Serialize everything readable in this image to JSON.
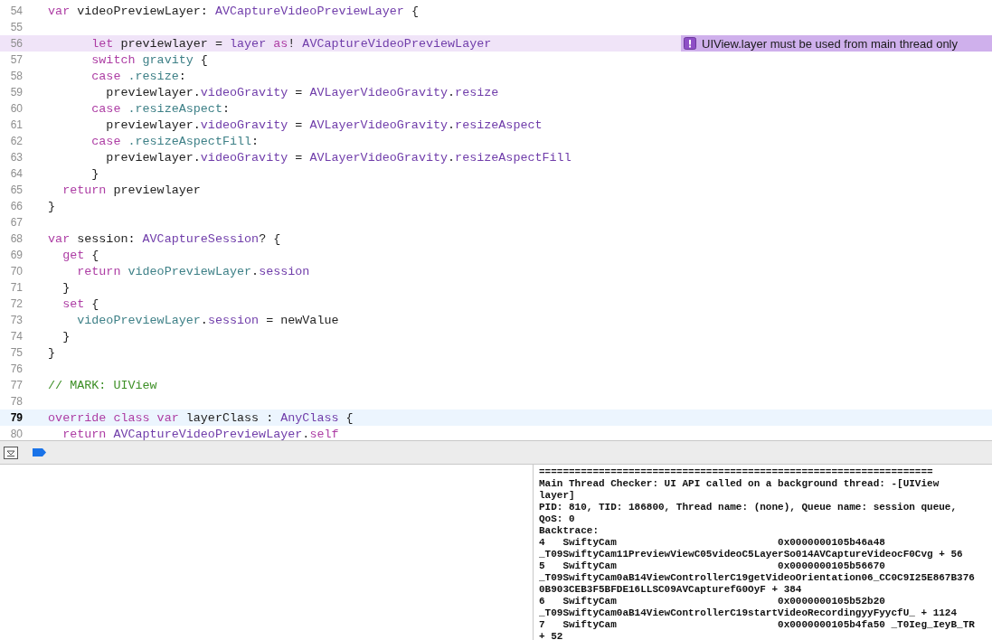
{
  "editor": {
    "lines": [
      {
        "number": "54",
        "kind": "normal",
        "tokens": [
          {
            "kind": "kw",
            "text": "  var"
          },
          {
            "kind": "plain",
            "text": " videoPreviewLayer: "
          },
          {
            "kind": "type",
            "text": "AVCaptureVideoPreviewLayer"
          },
          {
            "kind": "plain",
            "text": " {"
          }
        ]
      },
      {
        "number": "55",
        "kind": "normal"
      },
      {
        "number": "56",
        "kind": "issue",
        "issue": {
          "text": "UIView.layer must be used from main thread only"
        },
        "tokens": [
          {
            "kind": "kw",
            "text": "        let"
          },
          {
            "kind": "plain",
            "text": " previewlayer = "
          },
          {
            "kind": "sys",
            "text": "layer"
          },
          {
            "kind": "kw",
            "text": " as"
          },
          {
            "kind": "plain",
            "text": "! "
          },
          {
            "kind": "type",
            "text": "AVCaptureVideoPreviewLayer"
          }
        ]
      },
      {
        "number": "57",
        "kind": "normal",
        "tokens": [
          {
            "kind": "kw",
            "text": "        switch"
          },
          {
            "kind": "proj",
            "text": " gravity"
          },
          {
            "kind": "plain",
            "text": " {"
          }
        ]
      },
      {
        "number": "58",
        "kind": "normal",
        "tokens": [
          {
            "kind": "kw",
            "text": "        case"
          },
          {
            "kind": "proj",
            "text": " .resize"
          },
          {
            "kind": "plain",
            "text": ":"
          }
        ]
      },
      {
        "number": "59",
        "kind": "normal",
        "tokens": [
          {
            "kind": "plain",
            "text": "          previewlayer."
          },
          {
            "kind": "sys",
            "text": "videoGravity"
          },
          {
            "kind": "plain",
            "text": " = "
          },
          {
            "kind": "type",
            "text": "AVLayerVideoGravity"
          },
          {
            "kind": "plain",
            "text": "."
          },
          {
            "kind": "sys",
            "text": "resize"
          }
        ]
      },
      {
        "number": "60",
        "kind": "normal",
        "tokens": [
          {
            "kind": "kw",
            "text": "        case"
          },
          {
            "kind": "proj",
            "text": " .resizeAspect"
          },
          {
            "kind": "plain",
            "text": ":"
          }
        ]
      },
      {
        "number": "61",
        "kind": "normal",
        "tokens": [
          {
            "kind": "plain",
            "text": "          previewlayer."
          },
          {
            "kind": "sys",
            "text": "videoGravity"
          },
          {
            "kind": "plain",
            "text": " = "
          },
          {
            "kind": "type",
            "text": "AVLayerVideoGravity"
          },
          {
            "kind": "plain",
            "text": "."
          },
          {
            "kind": "sys",
            "text": "resizeAspect"
          }
        ]
      },
      {
        "number": "62",
        "kind": "normal",
        "tokens": [
          {
            "kind": "kw",
            "text": "        case"
          },
          {
            "kind": "proj",
            "text": " .resizeAspectFill"
          },
          {
            "kind": "plain",
            "text": ":"
          }
        ]
      },
      {
        "number": "63",
        "kind": "normal",
        "tokens": [
          {
            "kind": "plain",
            "text": "          previewlayer."
          },
          {
            "kind": "sys",
            "text": "videoGravity"
          },
          {
            "kind": "plain",
            "text": " = "
          },
          {
            "kind": "type",
            "text": "AVLayerVideoGravity"
          },
          {
            "kind": "plain",
            "text": "."
          },
          {
            "kind": "sys",
            "text": "resizeAspectFill"
          }
        ]
      },
      {
        "number": "64",
        "kind": "normal",
        "tokens": [
          {
            "kind": "plain",
            "text": "        }"
          }
        ]
      },
      {
        "number": "65",
        "kind": "normal",
        "tokens": [
          {
            "kind": "kw",
            "text": "    return"
          },
          {
            "kind": "plain",
            "text": " previewlayer"
          }
        ]
      },
      {
        "number": "66",
        "kind": "normal",
        "tokens": [
          {
            "kind": "plain",
            "text": "  }"
          }
        ]
      },
      {
        "number": "67",
        "kind": "normal"
      },
      {
        "number": "68",
        "kind": "normal",
        "tokens": [
          {
            "kind": "kw",
            "text": "  var"
          },
          {
            "kind": "plain",
            "text": " session: "
          },
          {
            "kind": "type",
            "text": "AVCaptureSession"
          },
          {
            "kind": "plain",
            "text": "? {"
          }
        ]
      },
      {
        "number": "69",
        "kind": "normal",
        "tokens": [
          {
            "kind": "kw",
            "text": "    get"
          },
          {
            "kind": "plain",
            "text": " {"
          }
        ]
      },
      {
        "number": "70",
        "kind": "normal",
        "tokens": [
          {
            "kind": "kw",
            "text": "      return"
          },
          {
            "kind": "proj",
            "text": " videoPreviewLayer"
          },
          {
            "kind": "plain",
            "text": "."
          },
          {
            "kind": "sys",
            "text": "session"
          }
        ]
      },
      {
        "number": "71",
        "kind": "normal",
        "tokens": [
          {
            "kind": "plain",
            "text": "    }"
          }
        ]
      },
      {
        "number": "72",
        "kind": "normal",
        "tokens": [
          {
            "kind": "kw",
            "text": "    set"
          },
          {
            "kind": "plain",
            "text": " {"
          }
        ]
      },
      {
        "number": "73",
        "kind": "normal",
        "tokens": [
          {
            "kind": "proj",
            "text": "      videoPreviewLayer"
          },
          {
            "kind": "plain",
            "text": "."
          },
          {
            "kind": "sys",
            "text": "session"
          },
          {
            "kind": "plain",
            "text": " = newValue"
          }
        ]
      },
      {
        "number": "74",
        "kind": "normal",
        "tokens": [
          {
            "kind": "plain",
            "text": "    }"
          }
        ]
      },
      {
        "number": "75",
        "kind": "normal",
        "tokens": [
          {
            "kind": "plain",
            "text": "  }"
          }
        ]
      },
      {
        "number": "76",
        "kind": "normal"
      },
      {
        "number": "77",
        "kind": "normal",
        "tokens": [
          {
            "kind": "comment",
            "text": "  // MARK: UIView"
          }
        ]
      },
      {
        "number": "78",
        "kind": "normal"
      },
      {
        "number": "79",
        "kind": "current",
        "tokens": [
          {
            "kind": "kw",
            "text": "  override class var"
          },
          {
            "kind": "plain",
            "text": " layerClass : "
          },
          {
            "kind": "type",
            "text": "AnyClass"
          },
          {
            "kind": "plain",
            "text": " {"
          }
        ]
      },
      {
        "number": "80",
        "kind": "normal",
        "tokens": [
          {
            "kind": "kw",
            "text": "    return"
          },
          {
            "kind": "type",
            "text": " AVCaptureVideoPreviewLayer"
          },
          {
            "kind": "plain",
            "text": "."
          },
          {
            "kind": "kw",
            "text": "self"
          }
        ]
      }
    ]
  },
  "console": {
    "lines": [
      "==================================================================",
      "Main Thread Checker: UI API called on a background thread: -[UIView",
      "layer]",
      "PID: 810, TID: 186800, Thread name: (none), Queue name: session queue,",
      "QoS: 0",
      "Backtrace:",
      "4   SwiftyCam                           0x0000000105b46a48",
      "_T09SwiftyCam11PreviewViewC05videoC5LayerSo014AVCaptureVideocF0Cvg + 56",
      "5   SwiftyCam                           0x0000000105b56670",
      "_T09SwiftyCam0aB14ViewControllerC19getVideoOrientation06_CC0C9I25E867B376",
      "0B903CEB3F5BFDE16LLSC09AVCapturefG0OyF + 384",
      "6   SwiftyCam                           0x0000000105b52b20",
      "_T09SwiftyCam0aB14ViewControllerC19startVideoRecordingyyFyycfU_ + 1124",
      "7   SwiftyCam                           0x0000000105b4fa50 _T0Ieg_IeyB_TR",
      "+ 52"
    ]
  }
}
